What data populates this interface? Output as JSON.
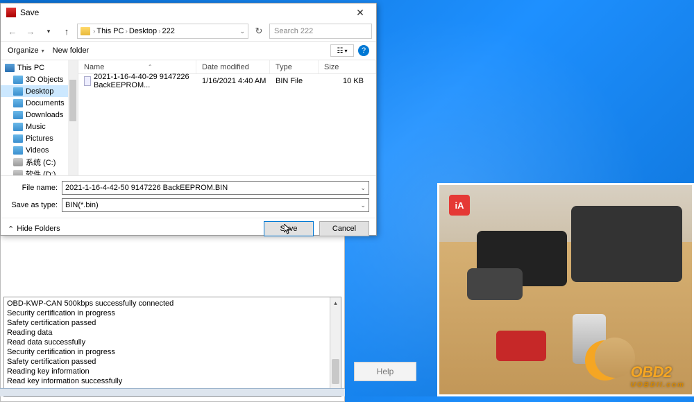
{
  "dialog": {
    "title": "Save",
    "nav": {
      "back": "←",
      "fwd": "→",
      "up": "↑",
      "refresh": "↻"
    },
    "path": [
      "This PC",
      "Desktop",
      "222"
    ],
    "search_placeholder": "Search 222",
    "organize": "Organize",
    "new_folder": "New folder",
    "view_glyph": "☷",
    "view_caret": "▾",
    "help_glyph": "?",
    "tree": [
      {
        "label": "This PC",
        "iconCls": "pc",
        "selected": false
      },
      {
        "label": "3D Objects",
        "iconCls": "blue",
        "selected": false
      },
      {
        "label": "Desktop",
        "iconCls": "blue",
        "selected": true
      },
      {
        "label": "Documents",
        "iconCls": "blue",
        "selected": false
      },
      {
        "label": "Downloads",
        "iconCls": "blue",
        "selected": false
      },
      {
        "label": "Music",
        "iconCls": "blue",
        "selected": false
      },
      {
        "label": "Pictures",
        "iconCls": "blue",
        "selected": false
      },
      {
        "label": "Videos",
        "iconCls": "blue",
        "selected": false
      },
      {
        "label": "系统 (C:)",
        "iconCls": "disk",
        "selected": false
      },
      {
        "label": "软件 (D:)",
        "iconCls": "disk",
        "selected": false
      }
    ],
    "columns": {
      "name": "Name",
      "date": "Date modified",
      "type": "Type",
      "size": "Size"
    },
    "files": [
      {
        "name": "2021-1-16-4-40-29 9147226 BackEEPROM...",
        "date": "1/16/2021 4:40 AM",
        "type": "BIN File",
        "size": "10 KB"
      }
    ],
    "filename_label": "File name:",
    "filename_value": "2021-1-16-4-42-50 9147226 BackEEPROM.BIN",
    "savetype_label": "Save as type:",
    "savetype_value": "BIN(*.bin)",
    "hide_folders": "Hide Folders",
    "hide_caret": "⌃",
    "save_btn": "Save",
    "cancel_btn": "Cancel"
  },
  "app": {
    "log": [
      "OBD-KWP-CAN 500kbps successfully connected",
      "Security certification in progress",
      "Safety certification passed",
      "Reading data",
      "Read data successfully",
      "Security certification in progress",
      "Safety certification passed",
      "Reading key information",
      "Read key information successfully"
    ],
    "help": "Help"
  },
  "webcam": {
    "badge": "iA",
    "logo_main": "OBD2",
    "logo_sub": "UOBDII.com"
  }
}
